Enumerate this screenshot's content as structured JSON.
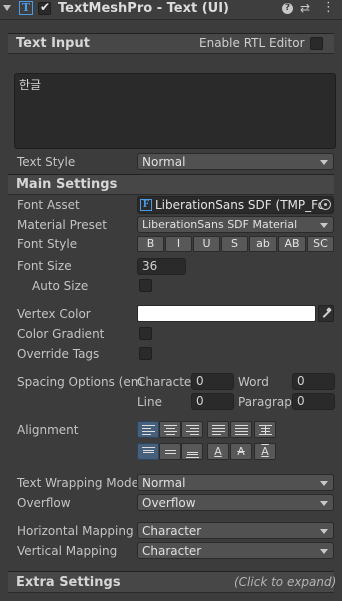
{
  "header": {
    "title": "TextMeshPro - Text (UI)",
    "component_icon": "T",
    "enabled": true,
    "help_icon": "?",
    "preset_icon": "⇄",
    "menu_icon": "⋮"
  },
  "text_input": {
    "section_title": "Text Input",
    "rtl_label": "Enable RTL Editor",
    "rtl_checked": false,
    "text_value": "한글",
    "text_style_label": "Text Style",
    "text_style_value": "Normal"
  },
  "main_settings": {
    "section_title": "Main Settings",
    "font_asset_label": "Font Asset",
    "font_asset_value": "LiberationSans SDF (TMP_Fo",
    "material_preset_label": "Material Preset",
    "material_preset_value": "LiberationSans SDF Material",
    "font_style_label": "Font Style",
    "font_style_buttons": [
      "B",
      "I",
      "U",
      "S",
      "ab",
      "AB",
      "SC"
    ],
    "font_size_label": "Font Size",
    "font_size_value": "36",
    "auto_size_label": "Auto Size",
    "vertex_color_label": "Vertex Color",
    "vertex_color": "#ffffff",
    "color_gradient_label": "Color Gradient",
    "override_tags_label": "Override Tags",
    "spacing_label": "Spacing Options (em)",
    "spacing_display": "Spacing Options (em",
    "character_label": "Character",
    "character_display": "Characte",
    "character_value": "0",
    "word_label": "Word",
    "word_value": "0",
    "line_label": "Line",
    "line_value": "0",
    "paragraph_label": "Paragraph",
    "paragraph_display": "Paragrapl",
    "paragraph_value": "0",
    "alignment_label": "Alignment",
    "horizontal_alignment_selected": "left",
    "vertical_alignment_selected": "top",
    "wrapping_label": "Text Wrapping Mode",
    "wrapping_value": "Normal",
    "overflow_label": "Overflow",
    "overflow_value": "Overflow",
    "h_mapping_label": "Horizontal Mapping",
    "h_mapping_value": "Character",
    "v_mapping_label": "Vertical Mapping",
    "v_mapping_value": "Character"
  },
  "extra_settings": {
    "section_title": "Extra Settings",
    "hint": "(Click to expand)"
  },
  "colors": {
    "panel_bg": "#3c3c3c",
    "section_bg": "#474747",
    "field_bg": "#2a2a2a",
    "dropdown_bg": "#515151",
    "selected_toggle": "#46607c",
    "icon_blue": "#4a9ce8"
  }
}
